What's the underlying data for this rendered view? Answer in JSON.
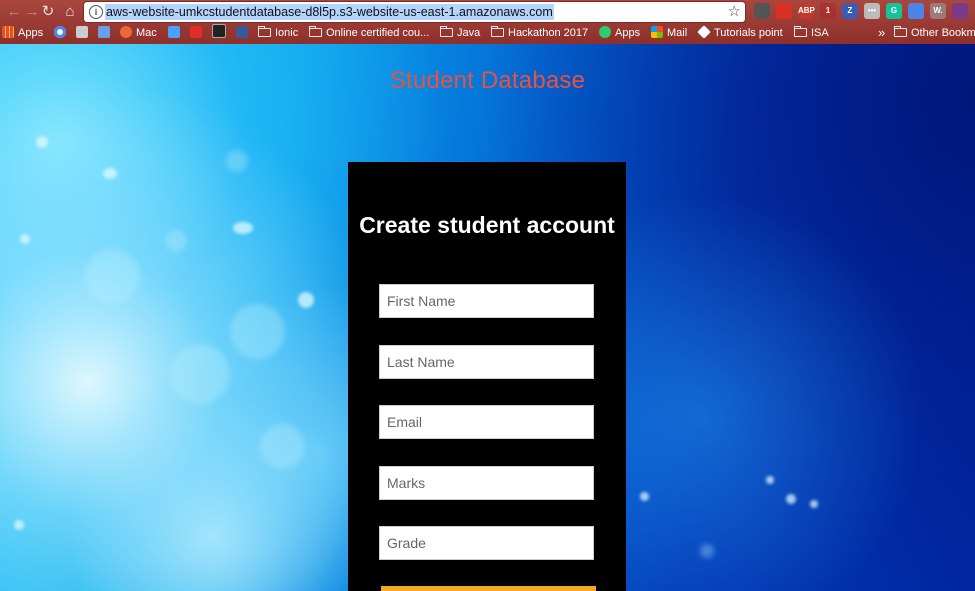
{
  "browser": {
    "url": "aws-website-umkcstudentdatabase-d8l5p.s3-website-us-east-1.amazonaws.com",
    "extensions": [
      {
        "icon": "download-arrow-icon",
        "text": "",
        "color": "#555555"
      },
      {
        "icon": "red-circle-extension-icon",
        "text": "",
        "color": "#d93025"
      },
      {
        "icon": "adblock-plus-icon",
        "text": "ABP",
        "color": "#c0392b"
      },
      {
        "icon": "ublock-icon",
        "text": "1",
        "color": "#a83232"
      },
      {
        "icon": "z-extension-icon",
        "text": "Z",
        "color": "#3b5bb5"
      },
      {
        "icon": "dots-extension-icon",
        "text": "•••",
        "color": "#bbbbbb"
      },
      {
        "icon": "grammarly-icon",
        "text": "G",
        "color": "#15c39a"
      },
      {
        "icon": "google-translate-icon",
        "text": "",
        "color": "#4a86e8"
      },
      {
        "icon": "w-extension-icon",
        "text": "W.",
        "color": "#9a7a7a"
      },
      {
        "icon": "corner-extension-icon",
        "text": "",
        "color": "#7a3a8a"
      }
    ]
  },
  "bookmarks": {
    "items": [
      {
        "label": "Apps",
        "icon": "apps-grid-icon"
      },
      {
        "label": "",
        "icon": "google-icon"
      },
      {
        "label": "",
        "icon": "photo-bookmark-icon"
      },
      {
        "label": "",
        "icon": "tag-bookmark-icon"
      },
      {
        "label": "Mac",
        "icon": "mac-app-icon"
      },
      {
        "label": "",
        "icon": "bird-bookmark-icon"
      },
      {
        "label": "",
        "icon": "youtube-icon"
      },
      {
        "label": "",
        "icon": "tv-bookmark-icon"
      },
      {
        "label": "",
        "icon": "facebook-icon"
      },
      {
        "label": "Ionic",
        "icon": "folder-icon"
      },
      {
        "label": "Online certified cou...",
        "icon": "folder-icon"
      },
      {
        "label": "Java",
        "icon": "folder-icon"
      },
      {
        "label": "Hackathon 2017",
        "icon": "folder-icon"
      },
      {
        "label": "Apps",
        "icon": "apps-green-icon"
      },
      {
        "label": "Mail",
        "icon": "microsoft-icon"
      },
      {
        "label": "Tutorials point",
        "icon": "tutorialspoint-icon"
      },
      {
        "label": "ISA",
        "icon": "folder-icon"
      }
    ],
    "overflow": "»",
    "other": "Other Bookma"
  },
  "page": {
    "title": "Student Database",
    "form": {
      "heading": "Create student account",
      "fields": [
        {
          "name": "first-name-input",
          "placeholder": "First Name",
          "value": ""
        },
        {
          "name": "last-name-input",
          "placeholder": "Last Name",
          "value": ""
        },
        {
          "name": "email-input",
          "placeholder": "Email",
          "value": ""
        },
        {
          "name": "marks-input",
          "placeholder": "Marks",
          "value": ""
        },
        {
          "name": "grade-input",
          "placeholder": "Grade",
          "value": ""
        }
      ],
      "submit_color": "#f5a623"
    }
  },
  "colors": {
    "title": "#e8523e",
    "card": "#000000",
    "chrome": "#9a3a33"
  }
}
